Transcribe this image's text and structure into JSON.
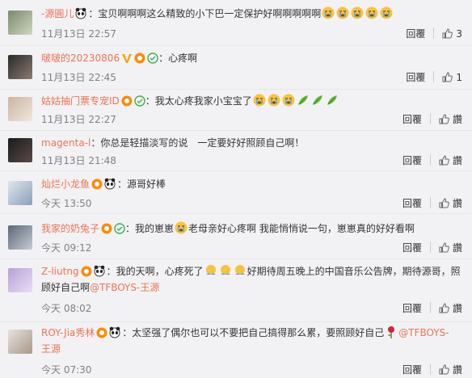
{
  "actions": {
    "reply": "回覆",
    "like_fallback": "讚"
  },
  "comments": [
    {
      "user": "-源圓儿",
      "text": "宝贝啊啊啊这么精致的小下巴一定保护好啊啊啊啊啊",
      "time": "11月13日 22:57",
      "likes": "3"
    },
    {
      "user": "啵啵的20230806",
      "text": "心疼啊",
      "time": "11月13日 22:45",
      "likes": "1"
    },
    {
      "user": "姑姑抽门票专宠ID",
      "text": "我太心疼我家小宝宝了",
      "time": "11月13日 22:27",
      "likes": "讚"
    },
    {
      "user": "magenta-l",
      "text": "你总是轻描淡写的说　一定要好好照顾自己啊！",
      "time": "11月13日 21:48",
      "likes": "讚"
    },
    {
      "user": "灿烂小龙鱼",
      "text": "源哥好棒",
      "time": "今天 13:50",
      "likes": "讚"
    },
    {
      "user": "我家的奶兔子",
      "text_a": "我的崽崽",
      "text_b": "老母亲好心疼啊 我能悄悄说一句，崽崽真的好好看啊",
      "time": "今天 09:12",
      "likes": "讚"
    },
    {
      "user": "Z-liutng",
      "text_a": "我的天啊，心疼死了",
      "text_b": "好期待周五晚上的中国音乐公告牌，期待源哥，照",
      "text_c": "顾好自己啊",
      "mention": "@TFBOYS-王源",
      "time": "今天 08:02",
      "likes": "讚"
    },
    {
      "user": "ROY-Jia秀林",
      "text": "太坚强了偶尔也可以不要把自己搞得那么累，要照顾好自己",
      "mention_a": "@TFBOYS-",
      "mention_b": "王源",
      "time": "今天 07:30",
      "likes": "讚"
    }
  ]
}
